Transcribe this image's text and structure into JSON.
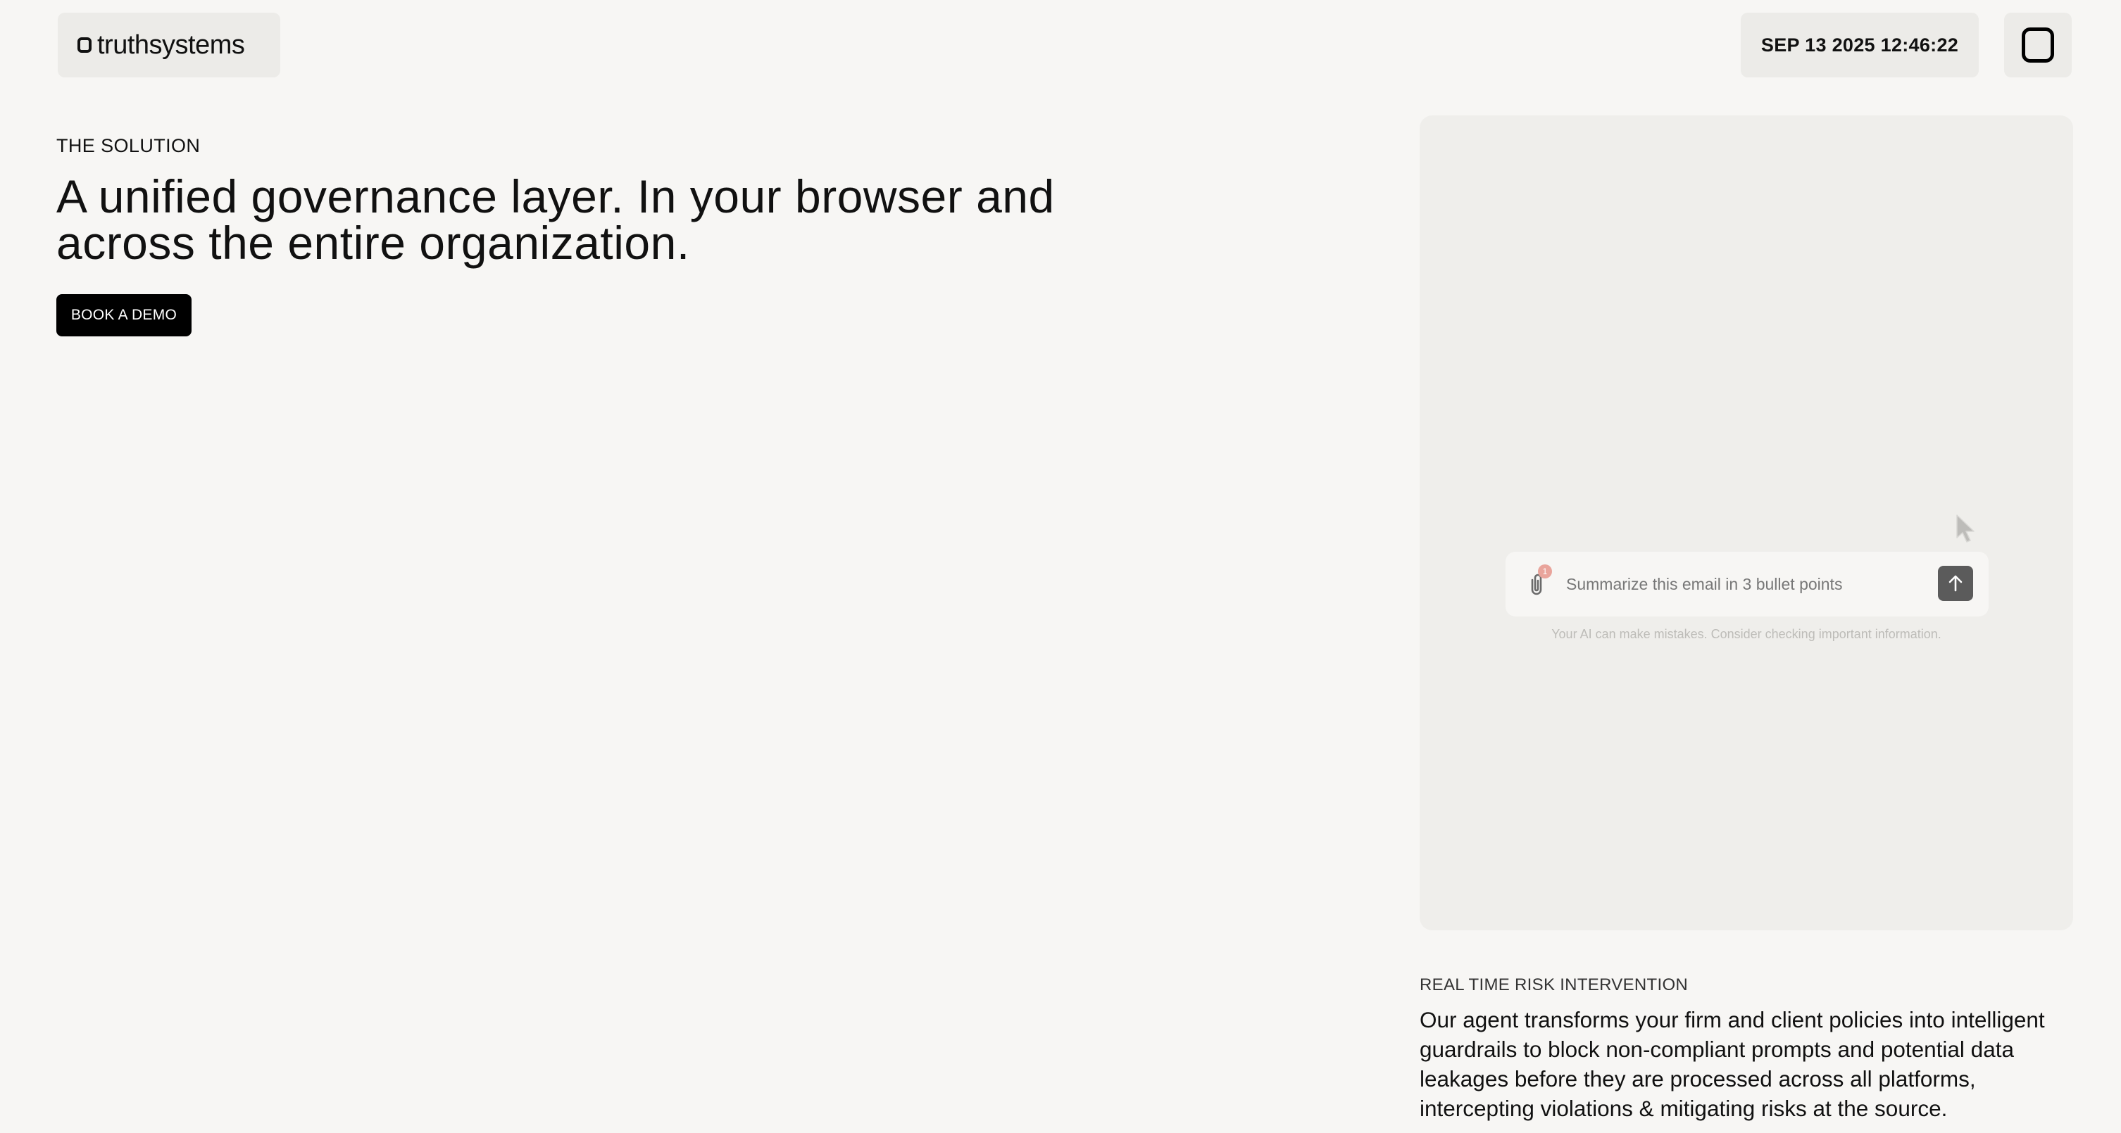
{
  "header": {
    "logo_text": "truthsystems",
    "datetime": "SEP 13 2025 12:46:22",
    "menu_icon": "menu-square-icon"
  },
  "hero": {
    "eyebrow": "THE SOLUTION",
    "headline": "A unified governance layer. In your browser and across the entire organization.",
    "cta_label": "BOOK A DEMO"
  },
  "demo": {
    "input_placeholder": "Summarize this email in 3 bullet points",
    "attachment_badge": "1",
    "attachment_icon": "paperclip-icon",
    "send_icon": "arrow-up-icon",
    "cursor_icon": "mouse-pointer-icon",
    "disclaimer": "Your AI can make mistakes. Consider checking important information.",
    "colors": {
      "badge": "#e9a49b",
      "send_button": "#5b5b5b",
      "panel": "#efeeeb"
    }
  },
  "feature": {
    "eyebrow": "REAL TIME RISK INTERVENTION",
    "body": "Our agent transforms your firm and client policies into intelligent guardrails to block non-compliant prompts and potential data leakages before they are processed across all platforms, intercepting violations & mitigating risks at the source."
  },
  "colors": {
    "background": "#f7f6f4",
    "header_box": "#ecebe8",
    "cta_background": "#000000",
    "text": "#111111"
  }
}
